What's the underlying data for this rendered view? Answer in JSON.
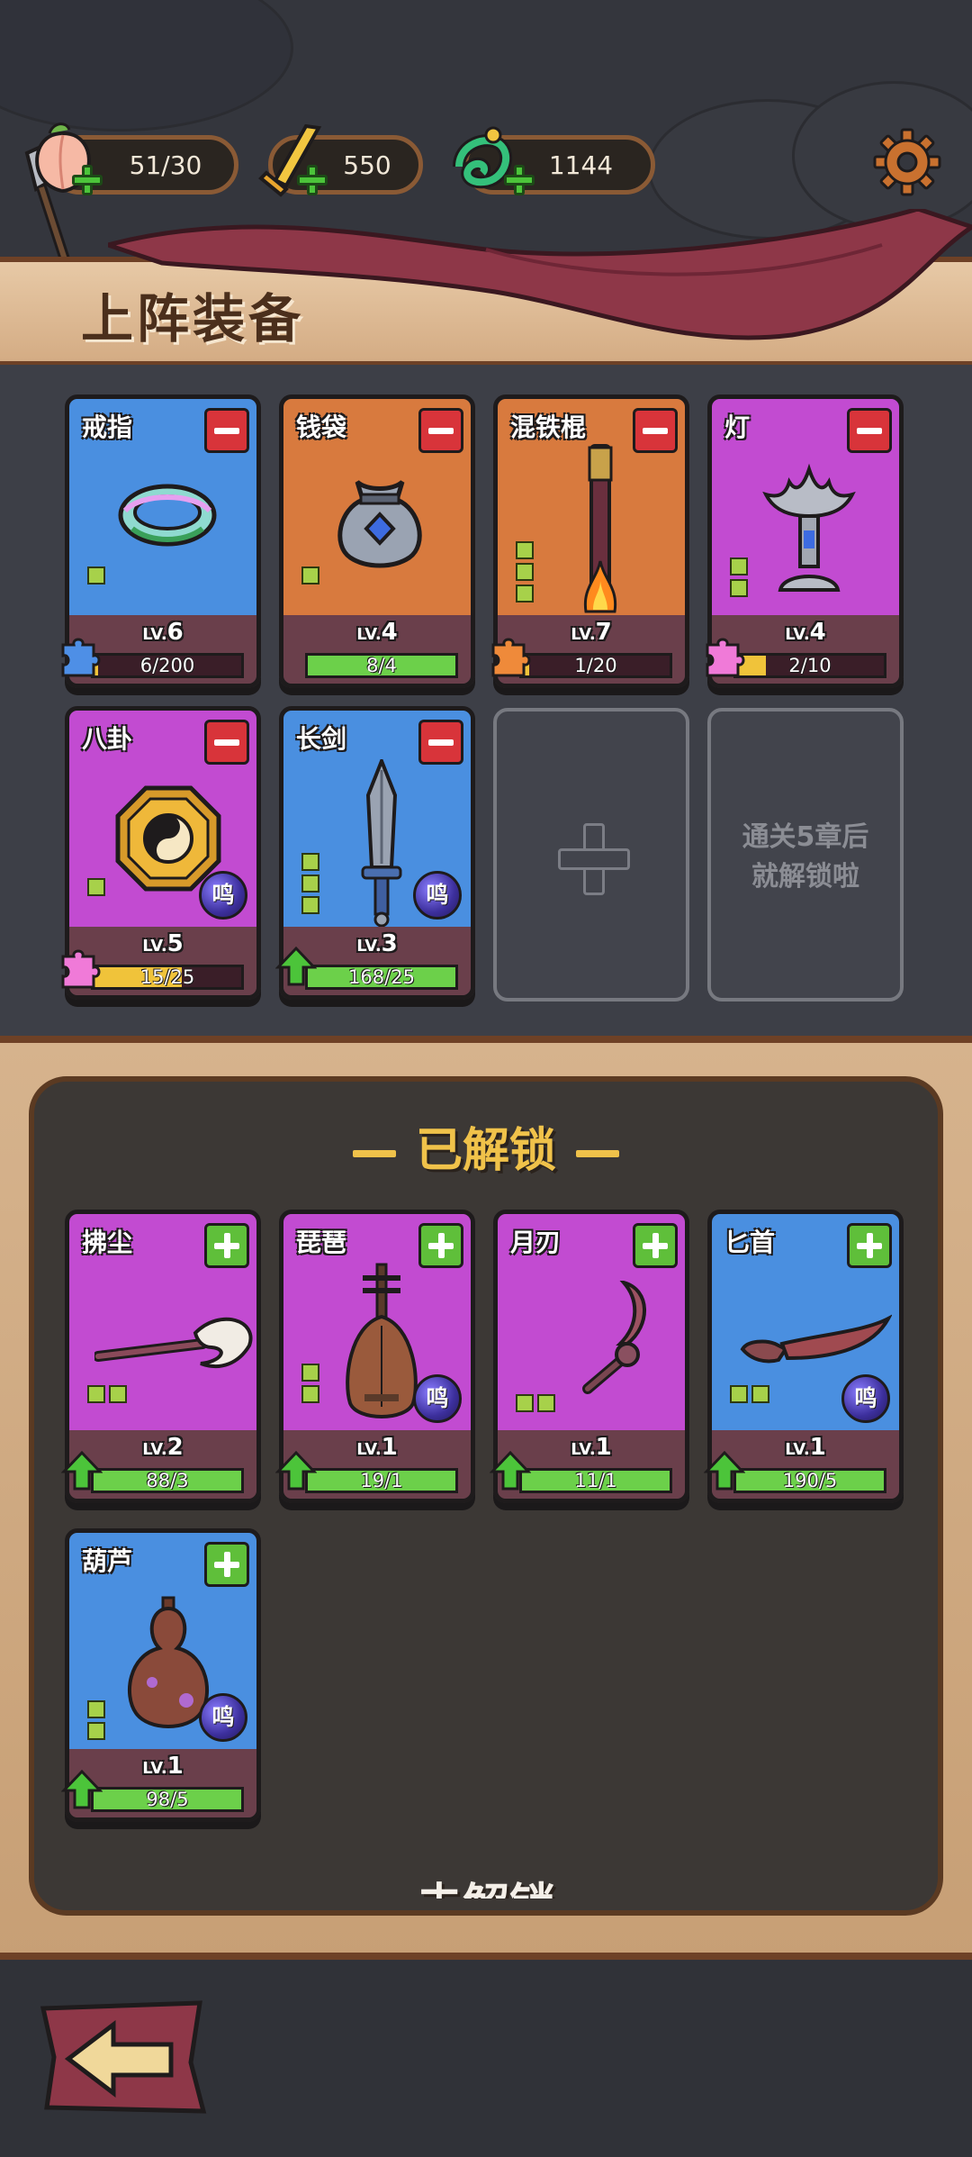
{
  "resources": [
    {
      "name": "peach",
      "value": "51/30"
    },
    {
      "name": "sword-token",
      "value": "550"
    },
    {
      "name": "jade",
      "value": "1144"
    }
  ],
  "banner": {
    "title": "上阵装备"
  },
  "equipped": [
    {
      "name": "戒指",
      "color": "blue",
      "lv": "6",
      "progress": "6/200",
      "fill": 0.03,
      "bar_color": "#f0c33a",
      "badge": "puzzle-blue"
    },
    {
      "name": "钱袋",
      "color": "orange",
      "lv": "4",
      "progress": "8/4",
      "fill": 1.0,
      "bar_color": "#6cd04a",
      "badge": ""
    },
    {
      "name": "混铁棍",
      "color": "orange",
      "lv": "7",
      "progress": "1/20",
      "fill": 0.05,
      "bar_color": "#f0c33a",
      "badge": "puzzle-orange"
    },
    {
      "name": "灯",
      "color": "purple",
      "lv": "4",
      "progress": "2/10",
      "fill": 0.2,
      "bar_color": "#f0c33a",
      "badge": "puzzle-pink"
    },
    {
      "name": "八卦",
      "color": "purple",
      "lv": "5",
      "progress": "15/25",
      "fill": 0.6,
      "bar_color": "#f0c33a",
      "badge": "puzzle-pink",
      "ming": "鸣"
    },
    {
      "name": "长剑",
      "color": "blue",
      "lv": "3",
      "progress": "168/25",
      "fill": 1.0,
      "bar_color": "#6cd04a",
      "badge": "up-arrow",
      "ming": "鸣"
    }
  ],
  "empty_slot": {
    "locked_text_1": "通关5章后",
    "locked_text_2": "就解锁啦"
  },
  "unlocked_title": "已解锁",
  "unlocked": [
    {
      "name": "拂尘",
      "color": "purple",
      "lv": "2",
      "progress": "88/3"
    },
    {
      "name": "琵琶",
      "color": "purple",
      "lv": "1",
      "progress": "19/1",
      "ming": "鸣"
    },
    {
      "name": "月刃",
      "color": "purple",
      "lv": "1",
      "progress": "11/1"
    },
    {
      "name": "匕首",
      "color": "blue",
      "lv": "1",
      "progress": "190/5",
      "ming": "鸣"
    },
    {
      "name": "葫芦",
      "color": "blue",
      "lv": "1",
      "progress": "98/5",
      "ming": "鸣"
    }
  ],
  "locked_title": "未解锁",
  "lv_label": "LV.",
  "icons": [
    "gear-icon",
    "back-arrow-icon",
    "peach-icon",
    "sword-token-icon",
    "jade-icon"
  ]
}
